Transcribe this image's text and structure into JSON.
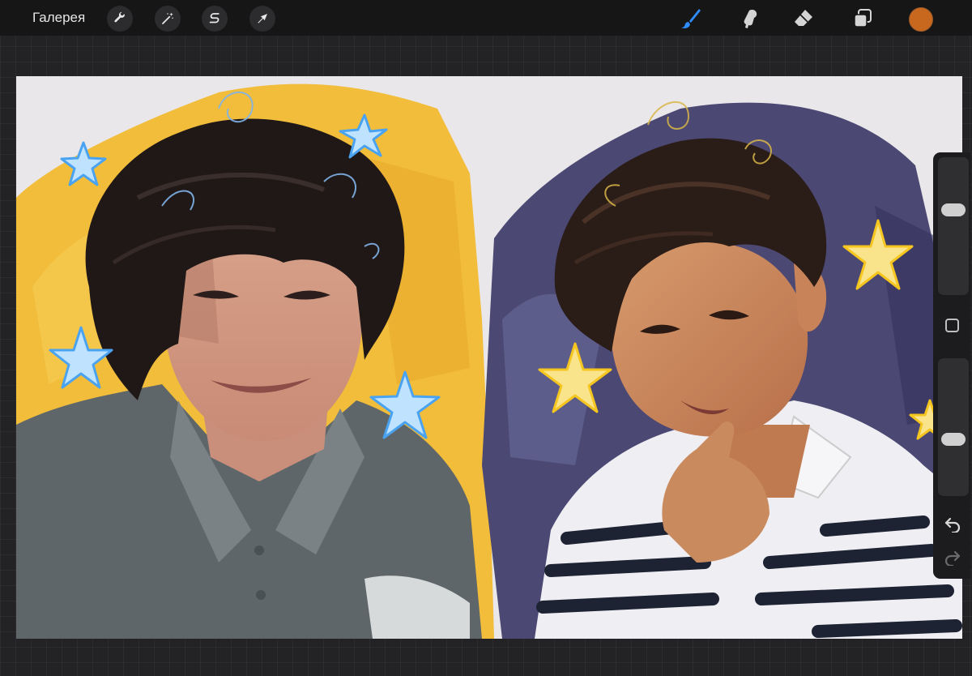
{
  "topbar": {
    "gallery_label": "Галерея",
    "left_tools": [
      {
        "icon": "wrench-icon",
        "name": "actions"
      },
      {
        "icon": "magic-wand-icon",
        "name": "adjustments"
      },
      {
        "icon": "selection-s-icon",
        "name": "selection"
      },
      {
        "icon": "arrow-cursor-icon",
        "name": "transform"
      }
    ],
    "right_tools": [
      {
        "icon": "brush-icon",
        "name": "brush",
        "active": true
      },
      {
        "icon": "smudge-icon",
        "name": "smudge"
      },
      {
        "icon": "eraser-icon",
        "name": "eraser"
      },
      {
        "icon": "layers-icon",
        "name": "layers"
      }
    ],
    "current_color": "#c8681e"
  },
  "colors": {
    "accent": "#2f8cff",
    "canvas_bg": "#e9e7ea",
    "left_background": "#f1bd3a",
    "right_background": "#4b4873"
  },
  "sidebar": {
    "brush_size_level": 0.63,
    "opacity_level": 0.4,
    "icons": [
      "modify-square-icon",
      "undo-icon",
      "redo-icon"
    ]
  }
}
